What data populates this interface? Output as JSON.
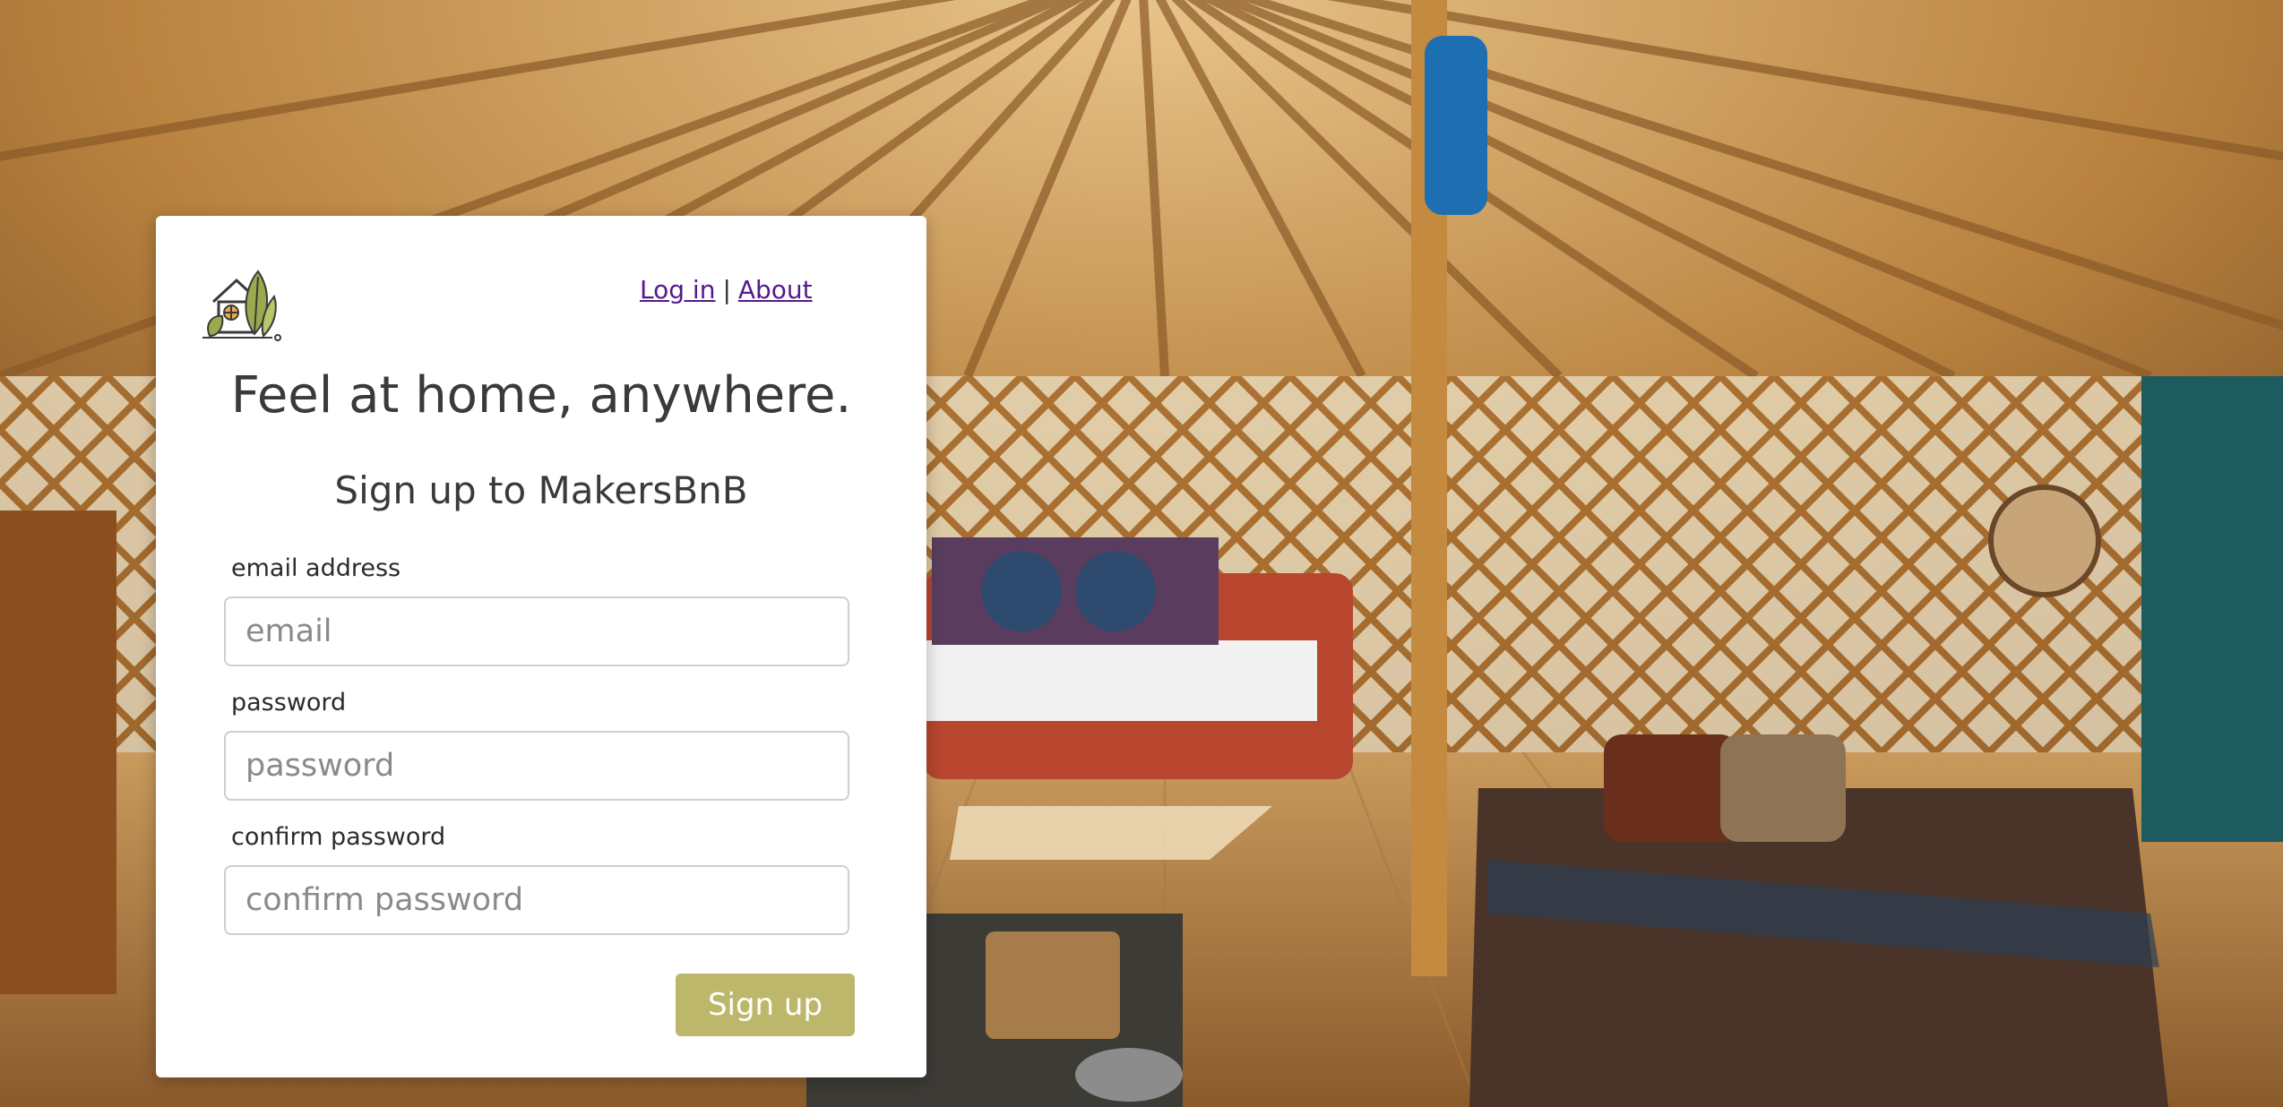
{
  "background": {
    "scene": "yurt-interior-photo"
  },
  "logo": {
    "icon": "house-leaf-logo-icon"
  },
  "nav": {
    "login": "Log in",
    "separator": "|",
    "about": "About"
  },
  "headline": "Feel at home, anywhere.",
  "form": {
    "title": "Sign up to MakersBnB",
    "email": {
      "label": "email address",
      "placeholder": "email",
      "value": ""
    },
    "password": {
      "label": "password",
      "placeholder": "password",
      "value": ""
    },
    "confirm": {
      "label": "confirm password",
      "placeholder": "confirm password",
      "value": ""
    },
    "submit_label": "Sign up"
  },
  "colors": {
    "button": "#bdb76b",
    "link": "#551a8b",
    "text": "#3a3a3a"
  }
}
